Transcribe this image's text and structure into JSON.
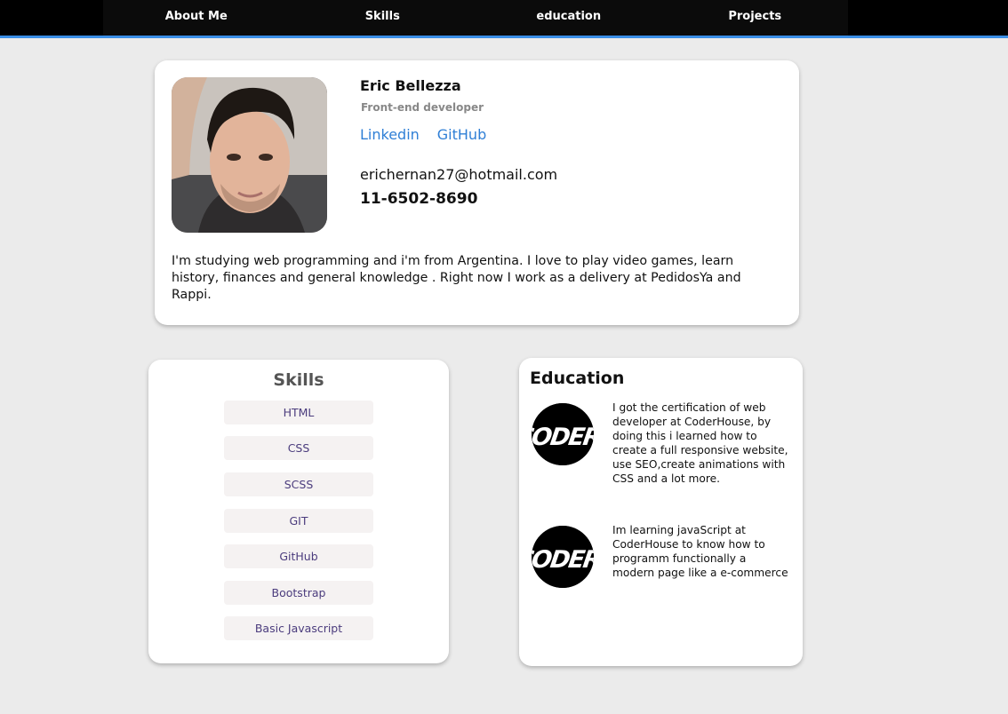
{
  "nav": {
    "items": [
      "About Me",
      "Skills",
      "education",
      "Projects"
    ]
  },
  "profile": {
    "name": "Eric Bellezza",
    "role": "Front-end developer",
    "links": [
      "Linkedin",
      "GitHub"
    ],
    "email": "erichernan27@hotmail.com",
    "phone": "11-6502-8690",
    "bio": "I'm studying web programming and i'm from Argentina. I love to play video games, learn history, finances and general knowledge . Right now I work as a delivery at PedidosYa and Rappi."
  },
  "skills": {
    "title": "Skills",
    "items": [
      "HTML",
      "CSS",
      "SCSS",
      "GIT",
      "GitHub",
      "Bootstrap",
      "Basic Javascript"
    ]
  },
  "education": {
    "title": "Education",
    "items": [
      {
        "logo": "CODER",
        "text": "I got the certification of web developer at CoderHouse, by doing this i learned how to create a full responsive website, use SEO,create animations with CSS and a lot more."
      },
      {
        "logo": "CODER",
        "text": "Im learning javaScript at CoderHouse to know how to programm functionally a modern page like a e-commerce"
      }
    ]
  },
  "colors": {
    "nav_bg": "#000000",
    "nav_underline": "#3a8ee6",
    "page_bg": "#ebebeb",
    "link": "#2f7fd6",
    "skill_text": "#4b3c7d",
    "skill_bg": "#f5f2f2"
  }
}
